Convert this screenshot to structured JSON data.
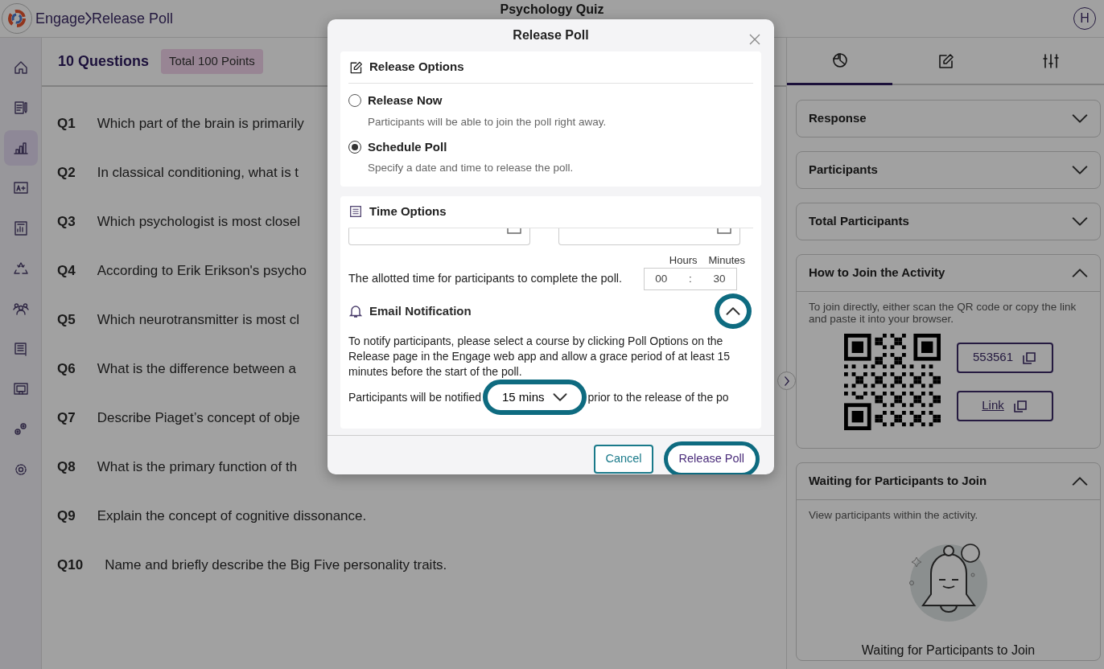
{
  "header": {
    "breadcrumb": [
      {
        "label": "Engage"
      },
      {
        "label": "Release Poll"
      }
    ],
    "title": "Psychology Quiz",
    "avatar": "H"
  },
  "sidebar": {
    "items": [
      {
        "kind": "home",
        "selected": false
      },
      {
        "kind": "form",
        "selected": false
      },
      {
        "kind": "chart",
        "selected": true
      },
      {
        "kind": "grade",
        "selected": false
      },
      {
        "kind": "report",
        "selected": false
      },
      {
        "kind": "recycle",
        "selected": false
      },
      {
        "kind": "people",
        "selected": false
      },
      {
        "kind": "list",
        "selected": false
      },
      {
        "kind": "screen",
        "selected": false
      },
      {
        "kind": "gears",
        "selected": false
      },
      {
        "kind": "settings",
        "selected": false
      }
    ]
  },
  "questions": {
    "count_label": "10 Questions",
    "points_badge": "Total 100 Points",
    "items": [
      {
        "number": "Q1",
        "text": "Which part of the brain is primarily"
      },
      {
        "number": "Q2",
        "text": "In classical conditioning, what is t"
      },
      {
        "number": "Q3",
        "text": "Which psychologist is most closel"
      },
      {
        "number": "Q4",
        "text": "According to Erik Erikson's psycho"
      },
      {
        "number": "Q5",
        "text": "Which neurotransmitter is most cl"
      },
      {
        "number": "Q6",
        "text": "What is the difference between a"
      },
      {
        "number": "Q7",
        "text": "Describe Piaget’s concept of obje"
      },
      {
        "number": "Q8",
        "text": "What is the primary function of th"
      },
      {
        "number": "Q9",
        "text": "Explain the concept of cognitive dissonance."
      },
      {
        "number": "Q10",
        "text": "Name and briefly describe the Big Five personality traits."
      }
    ]
  },
  "modal": {
    "title": "Release Poll",
    "release_options": {
      "title": "Release Options",
      "options": [
        {
          "label": "Release Now",
          "description": "Participants will be able to join the poll right away.",
          "selected": false
        },
        {
          "label": "Schedule Poll",
          "description": "Specify a date and time to release the poll.",
          "selected": true
        }
      ]
    },
    "time_options": {
      "title": "Time Options",
      "duration_label": "The allotted time for participants to complete the poll.",
      "hours_label": "Hours",
      "minutes_label": "Minutes",
      "hours": "00",
      "separator": ":",
      "minutes": "30",
      "email": {
        "title": "Email Notification",
        "expanded": true,
        "note": "To notify participants, please select a course by clicking Poll Options on the Release page in the Engage web app and allow a grace period of at least 15 minutes before the start of the poll.",
        "notify_prefix": "Participants will be notified",
        "notify_value": "15 mins",
        "notify_suffix": "prior to the release of the po"
      }
    },
    "buttons": {
      "cancel": "Cancel",
      "release": "Release Poll"
    }
  },
  "right_panel": {
    "tabs": [
      {
        "kind": "chart",
        "selected": true
      },
      {
        "kind": "edit",
        "selected": false
      },
      {
        "kind": "sliders",
        "selected": false
      }
    ],
    "accordions": [
      {
        "title": "Response",
        "expanded": false
      },
      {
        "title": "Participants",
        "expanded": false
      },
      {
        "title": "Total Participants",
        "expanded": false
      },
      {
        "kind": "join",
        "title": "How to Join the Activity",
        "expanded": true,
        "text": "To join directly, either scan the QR code or copy the link and paste it into your browser.",
        "code": "553561",
        "link": "Link"
      },
      {
        "kind": "waiting",
        "title": "Waiting for Participants to Join",
        "expanded": true,
        "text": "View participants within the activity.",
        "caption": "Waiting for Participants to Join"
      }
    ]
  }
}
